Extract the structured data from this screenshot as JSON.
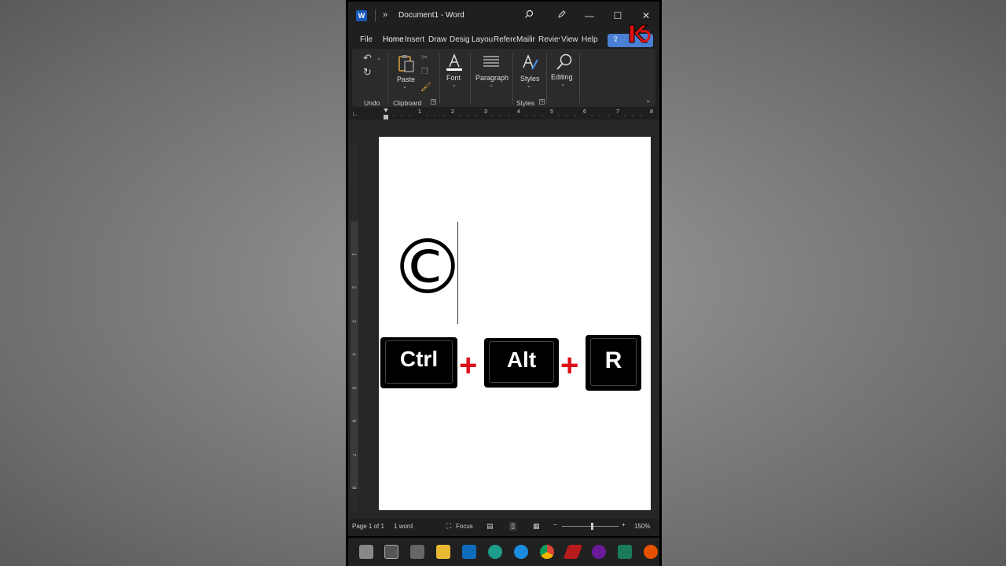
{
  "window": {
    "app_icon": "word-icon",
    "more": "»",
    "title": "Document1 - Word",
    "search_icon": "search-icon",
    "pen_icon": "pen-icon",
    "minimize": "—",
    "maximize": "☐",
    "close": "✕"
  },
  "tabs": [
    {
      "label": "File"
    },
    {
      "label": "Home"
    },
    {
      "label": "Insert"
    },
    {
      "label": "Draw"
    },
    {
      "label": "Desig"
    },
    {
      "label": "Layou"
    },
    {
      "label": "Refere"
    },
    {
      "label": "Mailir"
    },
    {
      "label": "Reviev"
    },
    {
      "label": "View"
    },
    {
      "label": "Help"
    }
  ],
  "ribbon": {
    "undo_group": "Undo",
    "paste": "Paste",
    "clipboard_group": "Clipboard",
    "font": "Font",
    "paragraph": "Paragraph",
    "styles": "Styles",
    "styles_group": "Styles",
    "editing": "Editing"
  },
  "ruler": {
    "numbers": [
      "1",
      "2",
      "3",
      "4",
      "5",
      "6",
      "7",
      "8"
    ]
  },
  "vruler": {
    "numbers": [
      "1",
      "2",
      "3",
      "4",
      "5",
      "6",
      "7",
      "8"
    ]
  },
  "document": {
    "symbol": "©",
    "keys": [
      {
        "label": "Ctrl"
      },
      {
        "label": "Alt"
      },
      {
        "label": "R"
      }
    ],
    "plus": "+"
  },
  "status": {
    "page": "Page 1 of 1",
    "words": "1 word",
    "focus": "Focus",
    "zoom_minus": "−",
    "zoom_plus": "+",
    "zoom": "150%"
  },
  "colors": {
    "accent": "#4a8ef5",
    "plus_red": "#e0101a",
    "word_blue": "#185abd"
  }
}
